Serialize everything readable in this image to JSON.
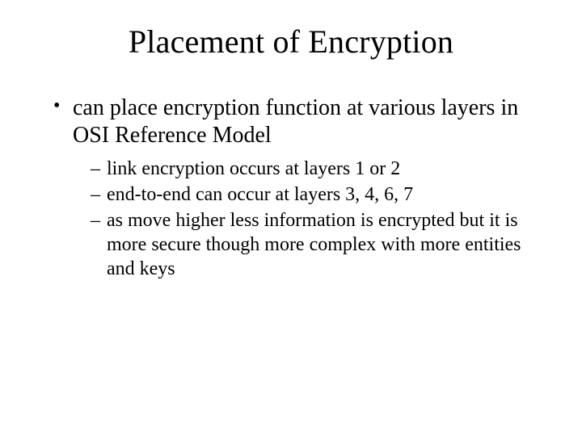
{
  "title": "Placement of Encryption",
  "bullets": {
    "level1": [
      {
        "text": "can place encryption function at various layers in OSI Reference Model",
        "children": [
          "link encryption occurs at layers 1 or 2",
          "end-to-end can occur at layers 3, 4, 6, 7",
          "as move higher less information is encrypted but it is more secure though more complex with more entities and keys"
        ]
      }
    ]
  }
}
